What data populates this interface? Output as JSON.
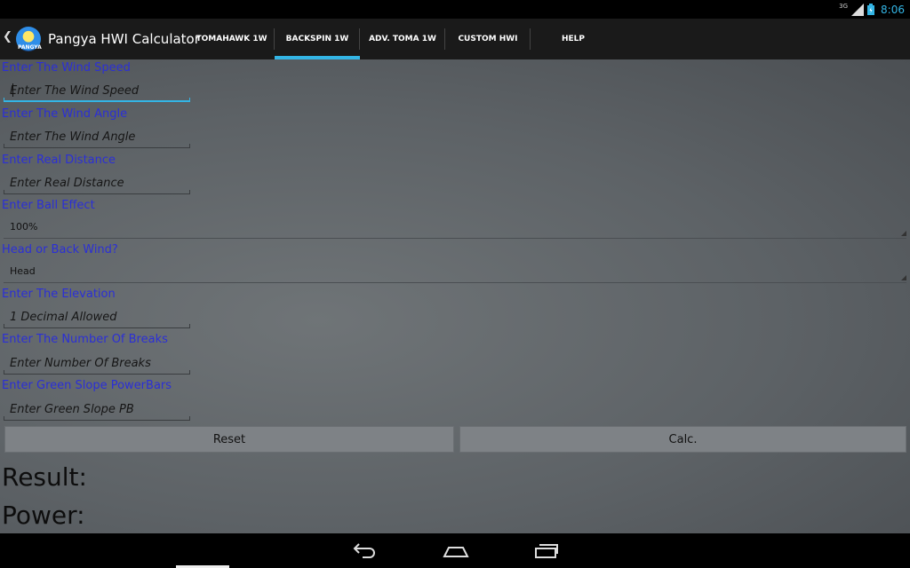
{
  "status_bar": {
    "network": "3G",
    "time": "8:06",
    "colors": {
      "accent": "#33b5e5"
    }
  },
  "action_bar": {
    "title": "Pangya HWI Calculator",
    "logo_text": "PANGYA",
    "tabs": [
      {
        "label": "TOMAHAWK 1W",
        "active": false
      },
      {
        "label": "BACKSPIN 1W",
        "active": true
      },
      {
        "label": "ADV. TOMA 1W",
        "active": false
      },
      {
        "label": "CUSTOM HWI",
        "active": false
      },
      {
        "label": "HELP",
        "active": false
      }
    ]
  },
  "form": {
    "wind_speed": {
      "label": "Enter The Wind Speed",
      "placeholder": "Enter The Wind Speed",
      "value": ""
    },
    "wind_angle": {
      "label": "Enter The Wind Angle",
      "placeholder": "Enter The Wind Angle",
      "value": ""
    },
    "real_distance": {
      "label": "Enter Real Distance",
      "placeholder": "Enter Real Distance",
      "value": ""
    },
    "ball_effect": {
      "label": "Enter Ball Effect",
      "selected": "100%"
    },
    "wind_direction": {
      "label": "Head or Back Wind?",
      "selected": "Head"
    },
    "elevation": {
      "label": "Enter The Elevation",
      "placeholder": "1 Decimal Allowed",
      "value": ""
    },
    "breaks": {
      "label": "Enter The Number Of Breaks",
      "placeholder": "Enter Number Of Breaks",
      "value": ""
    },
    "green_slope": {
      "label": "Enter Green Slope PowerBars",
      "placeholder": "Enter Green Slope PB",
      "value": ""
    }
  },
  "buttons": {
    "reset": "Reset",
    "calc": "Calc."
  },
  "output": {
    "result_label": "Result:",
    "power_label": "Power:"
  },
  "colors": {
    "label_blue": "#2b2fd6",
    "tab_indicator": "#33b5e5"
  }
}
